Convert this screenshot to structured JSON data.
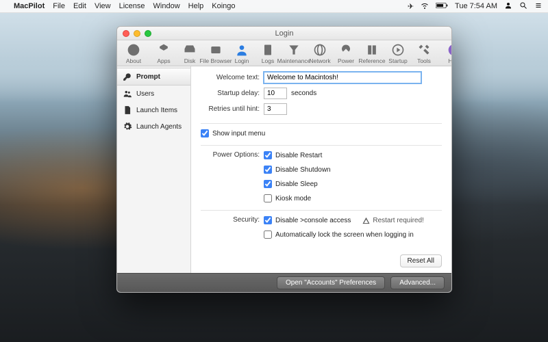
{
  "menubar": {
    "app": "MacPilot",
    "items": [
      "File",
      "Edit",
      "View",
      "License",
      "Window",
      "Help",
      "Koingo"
    ],
    "clock": "Tue 7:54 AM"
  },
  "window": {
    "title": "Login",
    "toolbar": {
      "about": "About",
      "apps": "Apps",
      "disk": "Disk",
      "filebrowser": "File Browser",
      "login": "Login",
      "logs": "Logs",
      "maintenance": "Maintenance",
      "network": "Network",
      "power": "Power",
      "reference": "Reference",
      "startup": "Startup",
      "tools": "Tools",
      "help": "Help"
    }
  },
  "sidebar": {
    "prompt": "Prompt",
    "users": "Users",
    "launchitems": "Launch Items",
    "launchagents": "Launch Agents"
  },
  "form": {
    "welcome_label": "Welcome text:",
    "welcome_value": "Welcome to Macintosh!",
    "startup_delay_label": "Startup delay:",
    "startup_delay_value": "10",
    "startup_delay_unit": "seconds",
    "retries_label": "Retries until hint:",
    "retries_value": "3",
    "show_input_menu": "Show input menu",
    "power_label": "Power Options:",
    "disable_restart": "Disable Restart",
    "disable_shutdown": "Disable Shutdown",
    "disable_sleep": "Disable Sleep",
    "kiosk": "Kiosk mode",
    "security_label": "Security:",
    "disable_console": "Disable >console access",
    "restart_required": "Restart required!",
    "autolock": "Automatically lock the screen when logging in",
    "reset": "Reset All"
  },
  "footer": {
    "accounts": "Open \"Accounts\" Preferences",
    "advanced": "Advanced..."
  }
}
